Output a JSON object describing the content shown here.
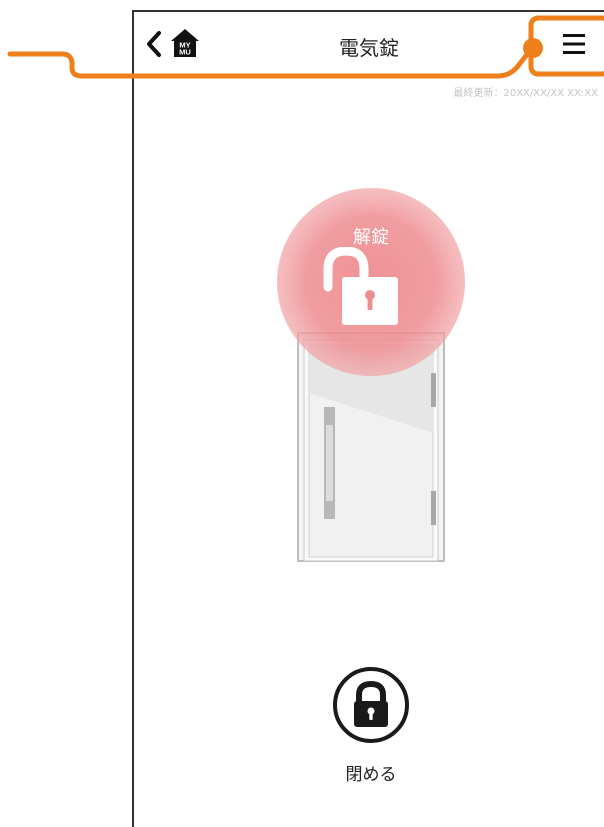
{
  "header": {
    "title": "電気錠",
    "home_badge": "MY MU",
    "last_updated": "最終更新：20XX/XX/XX XX:XX"
  },
  "lock_status": {
    "label": "解錠",
    "state": "unlocked",
    "color": "#ee8c90"
  },
  "lock_action": {
    "label": "閉める"
  },
  "callout": {
    "color": "#ee7f1a"
  },
  "icons": {
    "back": "chevron-left-icon",
    "home": "home-icon",
    "menu": "hamburger-menu-icon",
    "unlock": "padlock-open-icon",
    "lock": "padlock-closed-icon"
  }
}
